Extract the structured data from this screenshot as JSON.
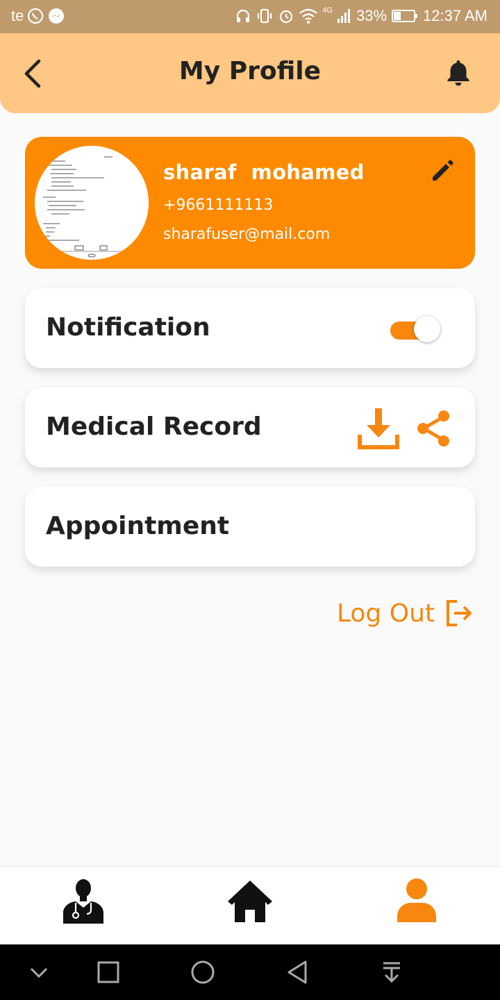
{
  "status_bar": {
    "carrier": "te",
    "network_type": "4G",
    "battery": "33%",
    "time": "12:37 AM"
  },
  "header": {
    "title": "My Profile",
    "back_icon": "chevron-left-icon",
    "notification_icon": "bell-icon"
  },
  "profile": {
    "name": "sharaf  mohamed",
    "phone": "+9661111113",
    "email": "sharafuser@mail.com",
    "edit_icon": "pencil-icon"
  },
  "options": {
    "notification": {
      "label": "Notification",
      "enabled": true
    },
    "medical_record": {
      "label": "Medical Record",
      "icons": [
        "download-icon",
        "share-icon"
      ]
    },
    "appointment": {
      "label": "Appointment"
    }
  },
  "logout": {
    "label": "Log Out",
    "icon": "logout-icon"
  },
  "bottom_nav": {
    "items": [
      {
        "icon": "doctor-icon",
        "active": false
      },
      {
        "icon": "home-icon",
        "active": false
      },
      {
        "icon": "user-icon",
        "active": true
      }
    ]
  },
  "colors": {
    "accent": "#fd8a00",
    "header_bg": "#ffc784",
    "status_bar_bg": "#bf9a6c",
    "text_dark": "#222222"
  }
}
